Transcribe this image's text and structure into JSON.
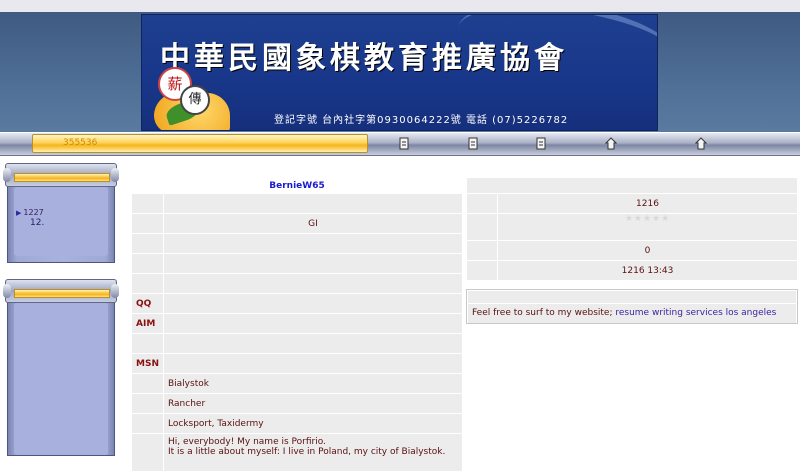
{
  "header": {
    "title_chars": "中華民國象棋教育推廣協會",
    "subtitle": "登記字號  台內社字第0930064222號        電話  (07)5226782",
    "logo_chars": [
      "薪",
      "傳"
    ]
  },
  "navbar": {
    "counter": "355536",
    "icons": [
      "document-icon",
      "document-icon",
      "document-icon",
      "home-icon",
      "home-icon"
    ]
  },
  "sidebar": {
    "panel1": {
      "item_count": "1227",
      "item_text": "12."
    }
  },
  "profile": {
    "username": "BernieW65",
    "rows": [
      {
        "label": "",
        "value": ""
      },
      {
        "label": "",
        "value": "GI"
      },
      {
        "label": "",
        "value": ""
      },
      {
        "label": "",
        "value": ""
      },
      {
        "label": "",
        "value": ""
      },
      {
        "label": "QQ",
        "value": ""
      },
      {
        "label": "AIM",
        "value": ""
      },
      {
        "label": "",
        "value": ""
      },
      {
        "label": "MSN",
        "value": ""
      },
      {
        "label": "",
        "value": "Bialystok"
      },
      {
        "label": "",
        "value": "Rancher"
      },
      {
        "label": "",
        "value": "Locksport, Taxidermy"
      },
      {
        "label": "",
        "value": "Hi, everybody! My name is Porfirio.\nIt is a little about myself: I live in Poland, my city of Bialystok."
      }
    ]
  },
  "stats": {
    "posts": "1216",
    "stars": "★★★★★",
    "value_zero": "0",
    "last_visit": "1216 13:43"
  },
  "signature": {
    "text": "Feel free to surf to my website; ",
    "link": "resume writing services los angeles"
  },
  "colors": {
    "banner_blue": "#1e3f8f",
    "gold": "#f5b41e",
    "link_blue": "#1a1ad0",
    "text_maroon": "#5a1010"
  }
}
